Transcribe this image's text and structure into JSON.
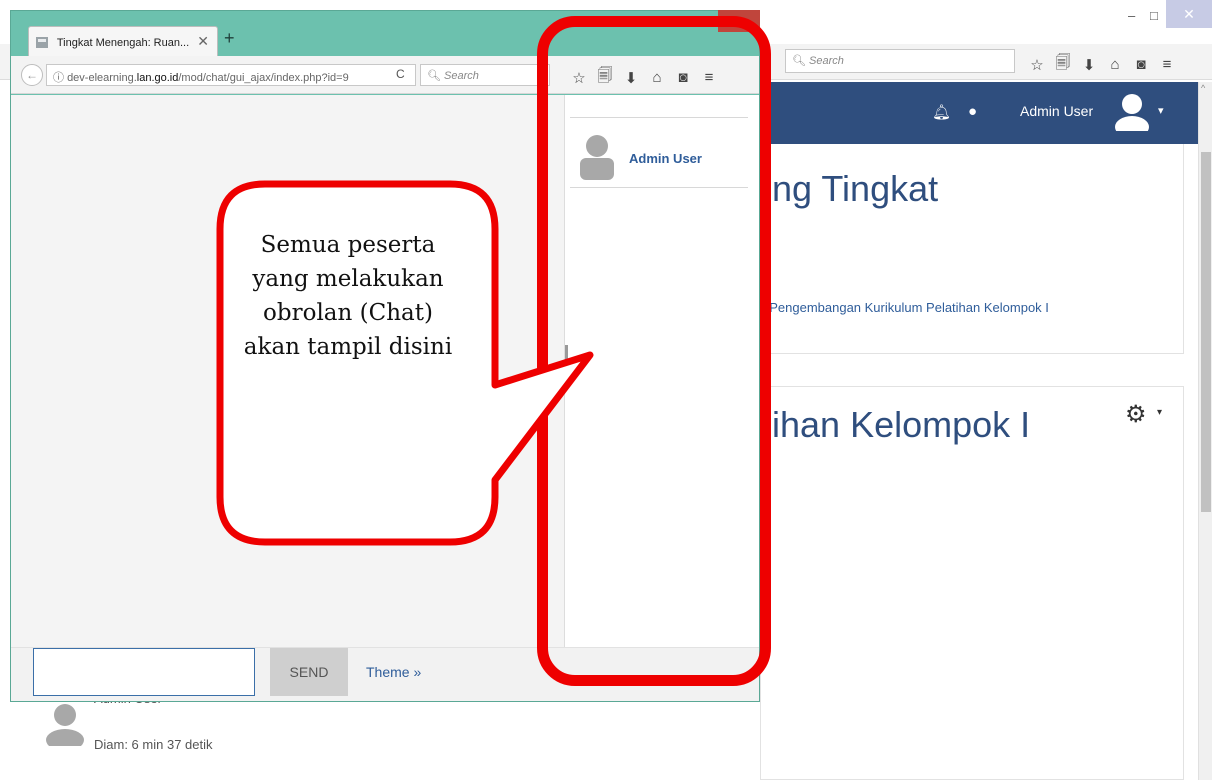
{
  "background_browser": {
    "search_placeholder": "Search",
    "window_controls": {
      "minimize": "–",
      "restore": "□",
      "close": "✕"
    },
    "toolbar_icons": [
      "star-icon",
      "reading-list-icon",
      "download-icon",
      "home-icon",
      "pocket-icon",
      "menu-icon"
    ],
    "header": {
      "user_name": "Admin User",
      "caret": "▾"
    },
    "page": {
      "title_fragment_1": "ng Tingkat",
      "subtitle_link": "t Pengembangan Kurikulum Pelatihan Kelompok I",
      "title_fragment_2": "ihan Kelompok I",
      "gear_caret": "▾"
    },
    "idle_user": {
      "name_cut": "Admin User",
      "idle_status": "Diam: 6 min 37 detik"
    }
  },
  "chat_popup": {
    "tab_title": "Tingkat Menengah: Ruan...",
    "tab_close": "✕",
    "new_tab": "+",
    "url_prefix": "dev-elearning.",
    "url_domain": "lan.go.id",
    "url_path": "/mod/chat/gui_ajax/index.php?id=9",
    "reload": "C",
    "search_placeholder": "Search",
    "users": [
      {
        "name": "Admin User"
      }
    ],
    "send_label": "SEND",
    "theme_label": "Theme »"
  },
  "annotation": {
    "callout_text": "Semua peserta yang melakukan obrolan (Chat) akan tampil disini",
    "highlight_color": "#ee0000"
  },
  "colors": {
    "header_blue": "#2f4e7e",
    "popup_frame": "#6cc1ae",
    "link_blue": "#2f5d9a"
  }
}
